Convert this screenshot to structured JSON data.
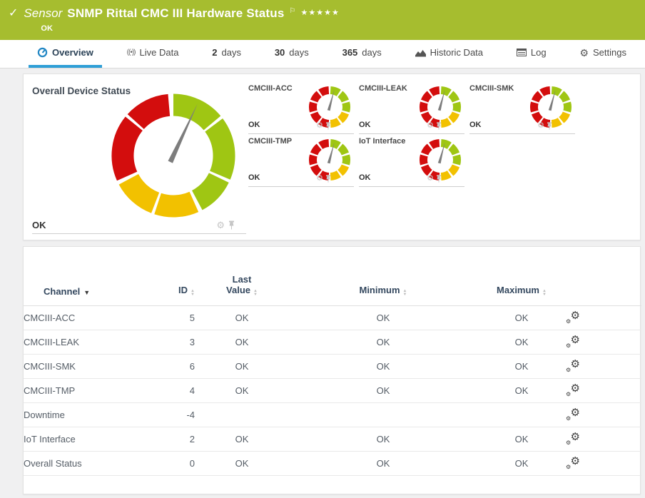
{
  "colors": {
    "header_green": "#a6bd2f",
    "green": "#9fc613",
    "yellow": "#f2c100",
    "red": "#d30d0d",
    "active_tab_blue": "#2f9fd7",
    "tab_icon_blue": "#2287c4",
    "needle_gray": "#7d7d7d",
    "icon_light_gray": "#c6c6c6",
    "table_header_navy": "#33475e"
  },
  "icons": {
    "check": "✓",
    "flag": "⚐",
    "stars": "★★★★★",
    "gear": "⚙",
    "sort_asc": "▲",
    "sort_desc": "▼",
    "live": "((•))"
  },
  "header": {
    "kind": "Sensor",
    "title": "SNMP Rittal CMC III Hardware Status",
    "status": "OK"
  },
  "tabs": [
    {
      "id": "overview",
      "num": "",
      "label": "Overview",
      "icon": "gauge",
      "active": true
    },
    {
      "id": "live-data",
      "num": "",
      "label": "Live Data",
      "icon": "live",
      "active": false
    },
    {
      "id": "2-days",
      "num": "2",
      "label": "days",
      "icon": "",
      "active": false
    },
    {
      "id": "30-days",
      "num": "30",
      "label": "days",
      "icon": "",
      "active": false
    },
    {
      "id": "365-days",
      "num": "365",
      "label": "days",
      "icon": "",
      "active": false
    },
    {
      "id": "historic-data",
      "num": "",
      "label": "Historic Data",
      "icon": "chart",
      "active": false
    },
    {
      "id": "log",
      "num": "",
      "label": "Log",
      "icon": "log",
      "active": false
    },
    {
      "id": "settings",
      "num": "",
      "label": "Settings",
      "icon": "gear",
      "active": false
    }
  ],
  "overview": {
    "overall": {
      "label": "Overall Device Status",
      "status": "OK"
    },
    "tiles": [
      {
        "label": "CMCIII-ACC",
        "status": "OK"
      },
      {
        "label": "CMCIII-LEAK",
        "status": "OK"
      },
      {
        "label": "CMCIII-SMK",
        "status": "OK"
      },
      {
        "label": "CMCIII-TMP",
        "status": "OK"
      },
      {
        "label": "IoT Interface",
        "status": "OK"
      }
    ]
  },
  "gauges": {
    "overall": {
      "needle_angle": 25,
      "segments": [
        [
          "green",
          0,
          50
        ],
        [
          "green",
          53,
          113
        ],
        [
          "green",
          116,
          152
        ],
        [
          "yellow",
          156,
          198
        ],
        [
          "yellow",
          201,
          242
        ],
        [
          "red",
          246,
          309
        ],
        [
          "red",
          312,
          355
        ]
      ]
    },
    "channel": {
      "needle_angle": 15,
      "segments": [
        [
          "green",
          3,
          33
        ],
        [
          "green",
          39,
          69
        ],
        [
          "green",
          75,
          105
        ],
        [
          "yellow",
          111,
          141
        ],
        [
          "yellow",
          147,
          177
        ],
        [
          "red",
          183,
          213
        ],
        [
          "red",
          219,
          249
        ],
        [
          "red",
          255,
          285
        ],
        [
          "red",
          291,
          321
        ],
        [
          "red",
          327,
          357
        ]
      ]
    }
  },
  "table": {
    "columns": [
      {
        "key": "channel",
        "label": "Channel",
        "sort": "desc"
      },
      {
        "key": "id",
        "label": "ID",
        "sort": "both"
      },
      {
        "key": "last",
        "label": "Last Value",
        "wrap": true,
        "sort": "both"
      },
      {
        "key": "min",
        "label": "Minimum",
        "sort": "both"
      },
      {
        "key": "max",
        "label": "Maximum",
        "sort": "both"
      },
      {
        "key": "gear",
        "label": "",
        "sort": "none"
      }
    ],
    "rows": [
      {
        "channel": "CMCIII-ACC",
        "id": "5",
        "last": "OK",
        "min": "OK",
        "max": "OK"
      },
      {
        "channel": "CMCIII-LEAK",
        "id": "3",
        "last": "OK",
        "min": "OK",
        "max": "OK"
      },
      {
        "channel": "CMCIII-SMK",
        "id": "6",
        "last": "OK",
        "min": "OK",
        "max": "OK"
      },
      {
        "channel": "CMCIII-TMP",
        "id": "4",
        "last": "OK",
        "min": "OK",
        "max": "OK"
      },
      {
        "channel": "Downtime",
        "id": "-4",
        "last": "",
        "min": "",
        "max": ""
      },
      {
        "channel": "IoT Interface",
        "id": "2",
        "last": "OK",
        "min": "OK",
        "max": "OK"
      },
      {
        "channel": "Overall Status",
        "id": "0",
        "last": "OK",
        "min": "OK",
        "max": "OK"
      }
    ]
  }
}
